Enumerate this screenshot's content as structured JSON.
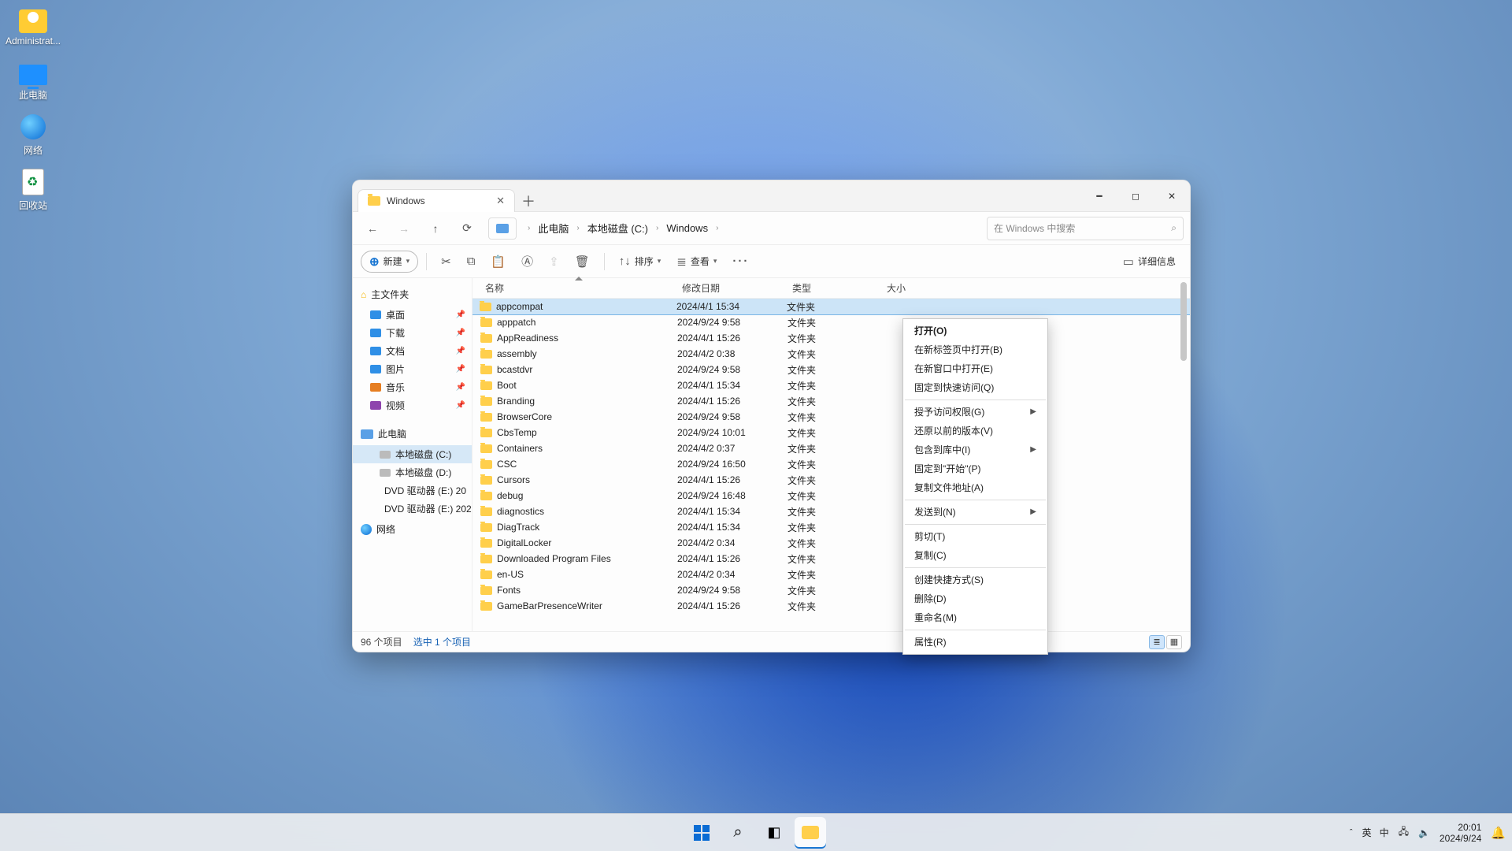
{
  "desktop": {
    "icons": [
      {
        "label": "Administrat...",
        "kind": "user"
      },
      {
        "label": "此电脑",
        "kind": "pc"
      },
      {
        "label": "网络",
        "kind": "globe"
      },
      {
        "label": "回收站",
        "kind": "recycle"
      }
    ]
  },
  "window": {
    "tab_title": "Windows",
    "breadcrumb": [
      "此电脑",
      "本地磁盘 (C:)",
      "Windows"
    ],
    "search_placeholder": "在 Windows 中搜索",
    "toolbar": {
      "new": "新建",
      "sort": "排序",
      "view": "查看",
      "details": "详细信息"
    },
    "sidebar": {
      "home": "主文件夹",
      "quick": [
        {
          "label": "桌面",
          "color": "#2f8fe6"
        },
        {
          "label": "下载",
          "color": "#2f8fe6"
        },
        {
          "label": "文档",
          "color": "#2f8fe6"
        },
        {
          "label": "图片",
          "color": "#2f8fe6"
        },
        {
          "label": "音乐",
          "color": "#e67e22"
        },
        {
          "label": "视频",
          "color": "#8e44ad"
        }
      ],
      "thispc": "此电脑",
      "drives": [
        {
          "label": "本地磁盘 (C:)",
          "sel": true
        },
        {
          "label": "本地磁盘 (D:)",
          "sel": false
        },
        {
          "label": "DVD 驱动器 (E:) 20",
          "sel": false
        },
        {
          "label": "DVD 驱动器 (E:) 202",
          "sel": false
        }
      ],
      "network": "网络"
    },
    "columns": {
      "name": "名称",
      "date": "修改日期",
      "type": "类型",
      "size": "大小"
    },
    "rows": [
      {
        "n": "appcompat",
        "d": "2024/4/1 15:34",
        "t": "文件夹",
        "sel": true
      },
      {
        "n": "apppatch",
        "d": "2024/9/24 9:58",
        "t": "文件夹"
      },
      {
        "n": "AppReadiness",
        "d": "2024/4/1 15:26",
        "t": "文件夹"
      },
      {
        "n": "assembly",
        "d": "2024/4/2 0:38",
        "t": "文件夹"
      },
      {
        "n": "bcastdvr",
        "d": "2024/9/24 9:58",
        "t": "文件夹"
      },
      {
        "n": "Boot",
        "d": "2024/4/1 15:34",
        "t": "文件夹"
      },
      {
        "n": "Branding",
        "d": "2024/4/1 15:26",
        "t": "文件夹"
      },
      {
        "n": "BrowserCore",
        "d": "2024/9/24 9:58",
        "t": "文件夹"
      },
      {
        "n": "CbsTemp",
        "d": "2024/9/24 10:01",
        "t": "文件夹"
      },
      {
        "n": "Containers",
        "d": "2024/4/2 0:37",
        "t": "文件夹"
      },
      {
        "n": "CSC",
        "d": "2024/9/24 16:50",
        "t": "文件夹"
      },
      {
        "n": "Cursors",
        "d": "2024/4/1 15:26",
        "t": "文件夹"
      },
      {
        "n": "debug",
        "d": "2024/9/24 16:48",
        "t": "文件夹"
      },
      {
        "n": "diagnostics",
        "d": "2024/4/1 15:34",
        "t": "文件夹"
      },
      {
        "n": "DiagTrack",
        "d": "2024/4/1 15:34",
        "t": "文件夹"
      },
      {
        "n": "DigitalLocker",
        "d": "2024/4/2 0:34",
        "t": "文件夹"
      },
      {
        "n": "Downloaded Program Files",
        "d": "2024/4/1 15:26",
        "t": "文件夹"
      },
      {
        "n": "en-US",
        "d": "2024/4/2 0:34",
        "t": "文件夹"
      },
      {
        "n": "Fonts",
        "d": "2024/9/24 9:58",
        "t": "文件夹"
      },
      {
        "n": "GameBarPresenceWriter",
        "d": "2024/4/1 15:26",
        "t": "文件夹"
      }
    ],
    "status": {
      "count": "96 个项目",
      "selected": "选中 1 个项目"
    }
  },
  "context_menu": [
    {
      "label": "打开(O)",
      "bold": true
    },
    {
      "label": "在新标签页中打开(B)"
    },
    {
      "label": "在新窗口中打开(E)"
    },
    {
      "label": "固定到快速访问(Q)"
    },
    {
      "sep": true
    },
    {
      "label": "授予访问权限(G)",
      "sub": true
    },
    {
      "label": "还原以前的版本(V)"
    },
    {
      "label": "包含到库中(I)",
      "sub": true
    },
    {
      "label": "固定到\"开始\"(P)"
    },
    {
      "label": "复制文件地址(A)"
    },
    {
      "sep": true
    },
    {
      "label": "发送到(N)",
      "sub": true
    },
    {
      "sep": true
    },
    {
      "label": "剪切(T)"
    },
    {
      "label": "复制(C)"
    },
    {
      "sep": true
    },
    {
      "label": "创建快捷方式(S)"
    },
    {
      "label": "删除(D)"
    },
    {
      "label": "重命名(M)"
    },
    {
      "sep": true
    },
    {
      "label": "属性(R)"
    }
  ],
  "taskbar": {
    "ime_lang": "英",
    "ime_mode": "中",
    "time": "20:01",
    "date": "2024/9/24"
  }
}
